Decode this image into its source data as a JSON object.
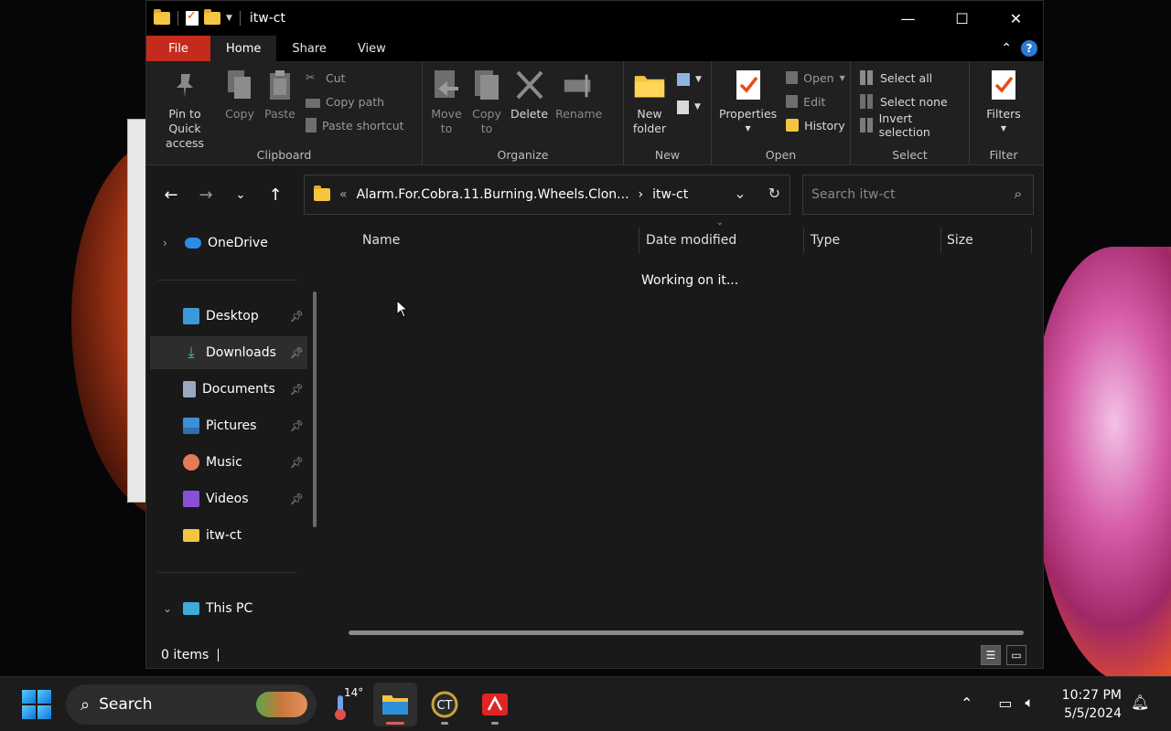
{
  "window": {
    "title": "itw-ct",
    "controls": {
      "minimize": "—",
      "maximize": "☐",
      "close": "✕"
    }
  },
  "ribbon_tabs": [
    "File",
    "Home",
    "Share",
    "View"
  ],
  "ribbon": {
    "clipboard": {
      "label": "Clipboard",
      "pin": "Pin to Quick access",
      "copy": "Copy",
      "paste": "Paste",
      "cut": "Cut",
      "copy_path": "Copy path",
      "paste_shortcut": "Paste shortcut"
    },
    "organize": {
      "label": "Organize",
      "move_to": "Move to",
      "copy_to": "Copy to",
      "delete": "Delete",
      "rename": "Rename"
    },
    "new": {
      "label": "New",
      "new_folder": "New folder"
    },
    "open": {
      "label": "Open",
      "properties": "Properties",
      "open": "Open",
      "edit": "Edit",
      "history": "History"
    },
    "select": {
      "label": "Select",
      "select_all": "Select all",
      "select_none": "Select none",
      "invert": "Invert selection"
    },
    "filter": {
      "label": "Filter",
      "filters": "Filters"
    }
  },
  "address": {
    "overflow": "«",
    "crumbs": [
      "Alarm.For.Cobra.11.Burning.Wheels.Clon...",
      "itw-ct"
    ],
    "separator": "›"
  },
  "search": {
    "placeholder": "Search itw-ct"
  },
  "nav_pane": {
    "onedrive": "OneDrive",
    "quick_access": [
      {
        "label": "Desktop",
        "icon": "desktop-icon",
        "color": "#3a9ad9"
      },
      {
        "label": "Downloads",
        "icon": "download-icon",
        "color": "#3fbf7f"
      },
      {
        "label": "Documents",
        "icon": "document-icon",
        "color": "#9aa8c4"
      },
      {
        "label": "Pictures",
        "icon": "picture-icon",
        "color": "#3a8fd6"
      },
      {
        "label": "Music",
        "icon": "music-icon",
        "color": "#e57a5a"
      },
      {
        "label": "Videos",
        "icon": "video-icon",
        "color": "#8a4fd8"
      },
      {
        "label": "itw-ct",
        "icon": "folder-icon",
        "color": "#f5c542"
      }
    ],
    "this_pc": "This PC"
  },
  "columns": [
    "Name",
    "Date modified",
    "Type",
    "Size"
  ],
  "content": {
    "status_message": "Working on it..."
  },
  "statusbar": {
    "count": "0 items"
  },
  "taskbar": {
    "search_label": "Search",
    "weather_temp": "14°",
    "time": "10:27 PM",
    "date": "5/5/2024"
  },
  "colors": {
    "accent_file_tab": "#c42b1c",
    "folder": "#f5c542",
    "help": "#2b7cd3"
  }
}
